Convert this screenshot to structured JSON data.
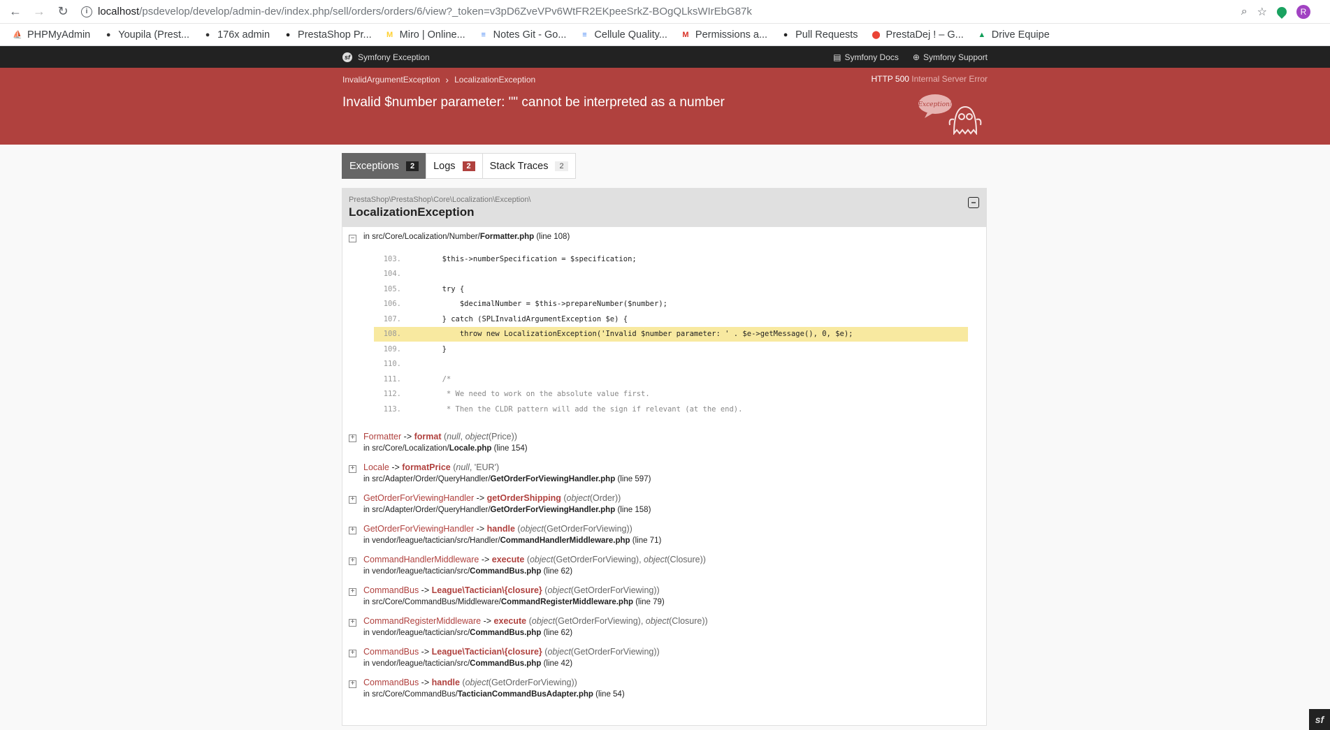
{
  "browser": {
    "url_host": "localhost",
    "url_path": "/psdevelop/develop/admin-dev/index.php/sell/orders/orders/6/view?_token=v3pD6ZveVPv6WtFR2EKpeeSrkZ-BOgQLksWIrEbG87k",
    "avatar_letter": "R"
  },
  "bookmarks": [
    {
      "label": "PHPMyAdmin",
      "icon": "phpmyadmin-icon",
      "color": "#f29111",
      "glyph": "⛵"
    },
    {
      "label": "Youpila (Prest...",
      "icon": "prestashop-icon",
      "color": "#333",
      "glyph": "●"
    },
    {
      "label": "176x admin",
      "icon": "prestashop-icon",
      "color": "#333",
      "glyph": "●"
    },
    {
      "label": "PrestaShop Pr...",
      "icon": "github-icon",
      "color": "#222",
      "glyph": "●"
    },
    {
      "label": "Miro | Online...",
      "icon": "miro-icon",
      "color": "#ffd02f",
      "glyph": "M"
    },
    {
      "label": "Notes Git - Go...",
      "icon": "docs-icon",
      "color": "#4285f4",
      "glyph": "≡"
    },
    {
      "label": "Cellule Quality...",
      "icon": "docs-icon",
      "color": "#4285f4",
      "glyph": "≡"
    },
    {
      "label": "Permissions a...",
      "icon": "gmail-icon",
      "color": "#d93025",
      "glyph": "M"
    },
    {
      "label": "Pull Requests",
      "icon": "github-icon",
      "color": "#222",
      "glyph": "●"
    },
    {
      "label": "PrestaDej ! – G...",
      "icon": "maps-icon",
      "color": "#ea4335",
      "glyph": "⬤"
    },
    {
      "label": "Drive Equipe",
      "icon": "drive-icon",
      "color": "#0f9d58",
      "glyph": "▲"
    }
  ],
  "symfony": {
    "brand": "Symfony Exception",
    "docs": "Symfony Docs",
    "support": "Symfony Support"
  },
  "error": {
    "crumb_1": "InvalidArgumentException",
    "crumb_2": "LocalizationException",
    "http_code": "HTTP 500",
    "http_text": "Internal Server Error",
    "message": "Invalid $number parameter: \"\" cannot be interpreted as a number",
    "ghost_text": "Exception!"
  },
  "tabs": [
    {
      "label": "Exceptions",
      "count": "2"
    },
    {
      "label": "Logs",
      "count": "2"
    },
    {
      "label": "Stack Traces",
      "count": "2"
    }
  ],
  "exception": {
    "namespace": "PrestaShop\\PrestaShop\\Core\\Localization\\Exception\\",
    "class": "LocalizationException",
    "first_file_prefix": "in src/Core/Localization/Number/",
    "first_file_name": "Formatter.php",
    "first_file_line": "(line 108)"
  },
  "code": [
    {
      "n": "103.",
      "src": "        $this->numberSpecification = $specification;"
    },
    {
      "n": "104.",
      "src": ""
    },
    {
      "n": "105.",
      "src": "        try {"
    },
    {
      "n": "106.",
      "src": "            $decimalNumber = $this->prepareNumber($number);"
    },
    {
      "n": "107.",
      "src": "        } catch (SPLInvalidArgumentException $e) {"
    },
    {
      "n": "108.",
      "src": "            throw new LocalizationException('Invalid $number parameter: ' . $e->getMessage(), 0, $e);"
    },
    {
      "n": "109.",
      "src": "        }"
    },
    {
      "n": "110.",
      "src": ""
    },
    {
      "n": "111.",
      "src": "        /*"
    },
    {
      "n": "112.",
      "src": "         * We need to work on the absolute value first."
    },
    {
      "n": "113.",
      "src": "         * Then the CLDR pattern will add the sign if relevant (at the end)."
    }
  ],
  "trace": [
    {
      "cls": "Formatter",
      "fn": "format",
      "args": [
        {
          "i": "null"
        },
        {
          "t": ", "
        },
        {
          "i": "object"
        },
        {
          "t": "(Price)"
        }
      ],
      "prefix": "in src/Core/Localization/",
      "file": "Locale.php",
      "line": "(line 154)"
    },
    {
      "cls": "Locale",
      "fn": "formatPrice",
      "args": [
        {
          "i": "null"
        },
        {
          "t": ", 'EUR'"
        }
      ],
      "prefix": "in src/Adapter/Order/QueryHandler/",
      "file": "GetOrderForViewingHandler.php",
      "line": "(line 597)"
    },
    {
      "cls": "GetOrderForViewingHandler",
      "fn": "getOrderShipping",
      "args": [
        {
          "i": "object"
        },
        {
          "t": "(Order)"
        }
      ],
      "prefix": "in src/Adapter/Order/QueryHandler/",
      "file": "GetOrderForViewingHandler.php",
      "line": "(line 158)"
    },
    {
      "cls": "GetOrderForViewingHandler",
      "fn": "handle",
      "args": [
        {
          "i": "object"
        },
        {
          "t": "(GetOrderForViewing)"
        }
      ],
      "prefix": "in vendor/league/tactician/src/Handler/",
      "file": "CommandHandlerMiddleware.php",
      "line": "(line 71)"
    },
    {
      "cls": "CommandHandlerMiddleware",
      "fn": "execute",
      "args": [
        {
          "i": "object"
        },
        {
          "t": "(GetOrderForViewing), "
        },
        {
          "i": "object"
        },
        {
          "t": "(Closure)"
        }
      ],
      "prefix": "in vendor/league/tactician/src/",
      "file": "CommandBus.php",
      "line": "(line 62)"
    },
    {
      "cls": "CommandBus",
      "fn": "League\\Tactician\\{closure}",
      "args": [
        {
          "i": "object"
        },
        {
          "t": "(GetOrderForViewing)"
        }
      ],
      "prefix": "in src/Core/CommandBus/Middleware/",
      "file": "CommandRegisterMiddleware.php",
      "line": "(line 79)"
    },
    {
      "cls": "CommandRegisterMiddleware",
      "fn": "execute",
      "args": [
        {
          "i": "object"
        },
        {
          "t": "(GetOrderForViewing), "
        },
        {
          "i": "object"
        },
        {
          "t": "(Closure)"
        }
      ],
      "prefix": "in vendor/league/tactician/src/",
      "file": "CommandBus.php",
      "line": "(line 62)"
    },
    {
      "cls": "CommandBus",
      "fn": "League\\Tactician\\{closure}",
      "args": [
        {
          "i": "object"
        },
        {
          "t": "(GetOrderForViewing)"
        }
      ],
      "prefix": "in vendor/league/tactician/src/",
      "file": "CommandBus.php",
      "line": "(line 42)"
    },
    {
      "cls": "CommandBus",
      "fn": "handle",
      "args": [
        {
          "i": "object"
        },
        {
          "t": "(GetOrderForViewing)"
        }
      ],
      "prefix": "in src/Core/CommandBus/",
      "file": "TacticianCommandBusAdapter.php",
      "line": "(line 54)"
    }
  ],
  "colors": {
    "error_red": "#b0413e",
    "dark_bar": "#222222",
    "highlight": "#f8e9a0"
  }
}
